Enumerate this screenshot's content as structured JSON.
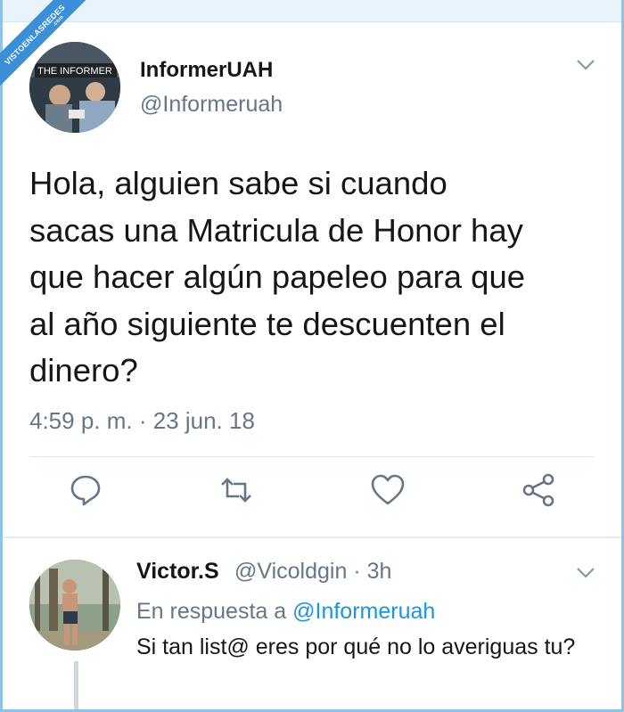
{
  "watermark": {
    "label": "VISTOENLASREDES",
    "suffix": ".com"
  },
  "tweet": {
    "author_name": "InformerUAH",
    "author_handle": "@Informeruah",
    "avatar_caption": "THE INFORMER",
    "text_lines": [
      "Hola, alguien sabe si cuando",
      "sacas una Matricula de Honor hay",
      "que hacer algún papeleo para que",
      "al año siguiente te descuenten el",
      "dinero?"
    ],
    "timestamp": "4:59 p. m. · 23 jun. 18",
    "actions": [
      "reply-icon",
      "retweet-icon",
      "like-icon",
      "share-icon"
    ]
  },
  "reply": {
    "author_name": "Victor.S",
    "author_handle_time": "@Vicoldgin · 3h",
    "in_reply_prefix": "En respuesta a ",
    "in_reply_handle": "@Informeruah",
    "text": "Si tan list@ eres por qué no lo averiguas tu?"
  },
  "colors": {
    "accent": "#1b95e0",
    "muted": "#657786",
    "text": "#14171a",
    "divider": "#e1e8ed"
  }
}
